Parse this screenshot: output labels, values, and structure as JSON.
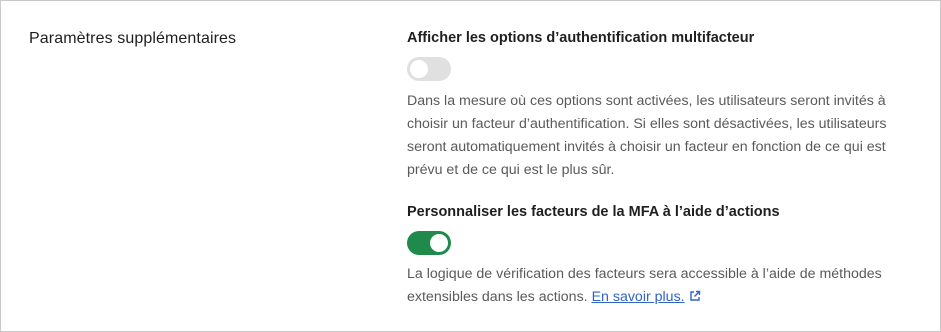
{
  "section": {
    "title": "Paramètres supplémentaires"
  },
  "settings": [
    {
      "title": "Afficher les options d’authentification multifacteur",
      "enabled": false,
      "description": "Dans la mesure où ces options sont activées, les utilisateurs seront invités à choisir un facteur d’authentification. Si elles sont désactivées, les utilisateurs seront automatiquement invités à choisir un facteur en fonction de ce qui est prévu et de ce qui est le plus sûr."
    },
    {
      "title": "Personnaliser les facteurs de la MFA à l’aide d’actions",
      "enabled": true,
      "description": "La logique de vérification des facteurs sera accessible à l’aide de méthodes extensibles dans les actions.",
      "link_text": "En savoir plus."
    }
  ],
  "colors": {
    "toggle_on": "#1f8a4c",
    "toggle_off": "#e0e0e0",
    "link": "#2f64c8"
  },
  "icons": {
    "learn_more": "external-link-icon"
  }
}
